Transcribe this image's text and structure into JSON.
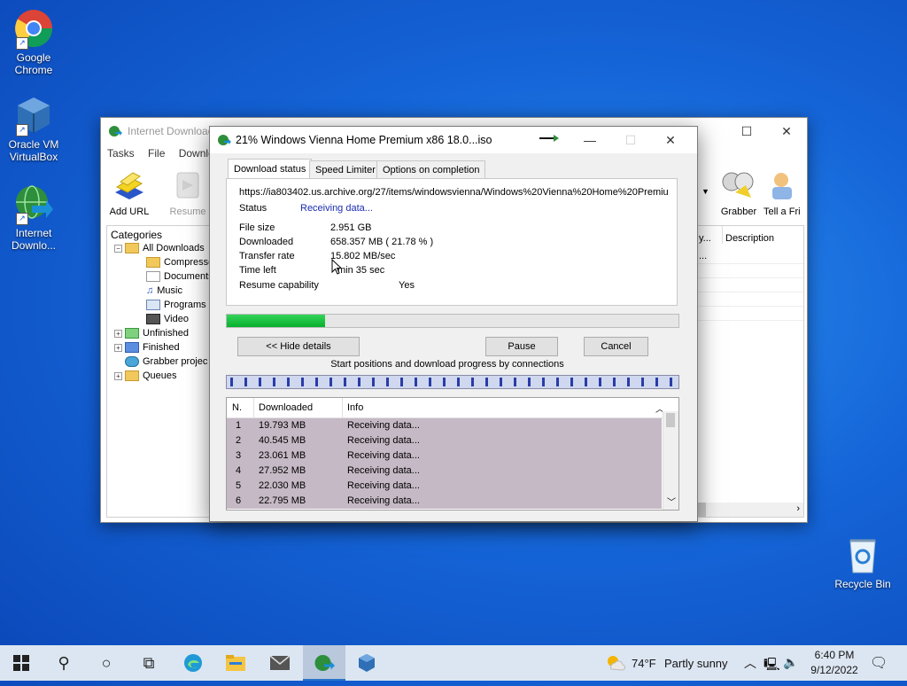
{
  "desktop": {
    "icons": [
      {
        "label": "Google Chrome"
      },
      {
        "label": "Oracle VM VirtualBox"
      },
      {
        "label": "Internet Downlo..."
      },
      {
        "label": "Recycle Bin"
      }
    ]
  },
  "idm": {
    "title": "Internet Download",
    "menu": [
      "Tasks",
      "File",
      "Downlo"
    ],
    "toolbar": {
      "add_url": "Add URL",
      "resume": "Resume",
      "grabber": "Grabber",
      "tell": "Tell a Fri"
    },
    "categories_header": "Categories",
    "tree": [
      "All Downloads",
      "Compresse",
      "Documents",
      "Music",
      "Programs",
      "Video",
      "Unfinished",
      "Finished",
      "Grabber projec",
      "Queues"
    ],
    "col_fragment": "y...",
    "col_fragment2": "...",
    "col_description": "Description"
  },
  "dialog": {
    "title": "21% Windows Vienna Home Premium x86 18.0...iso",
    "tabs": [
      "Download status",
      "Speed Limiter",
      "Options on completion"
    ],
    "url": "https://ia803402.us.archive.org/27/items/windowsvienna/Windows%20Vienna%20Home%20Premiu",
    "status_label": "Status",
    "status_value": "Receiving data...",
    "file_size_label": "File size",
    "file_size_value": "2.951  GB",
    "downloaded_label": "Downloaded",
    "downloaded_value": "658.357  MB  ( 21.78 % )",
    "transfer_label": "Transfer rate",
    "transfer_value": "15.802  MB/sec",
    "time_left_label": "Time left",
    "time_left_value": "min 35 sec",
    "resume_label": "Resume capability",
    "resume_value": "Yes",
    "progress": 0.2178,
    "hide_details": "<< Hide details",
    "pause": "Pause",
    "cancel": "Cancel",
    "connections_caption": "Start positions and download progress by connections",
    "list_headers": [
      "N.",
      "Downloaded",
      "Info"
    ],
    "connections": [
      {
        "n": "1",
        "downloaded": "19.793  MB",
        "info": "Receiving data..."
      },
      {
        "n": "2",
        "downloaded": "40.545  MB",
        "info": "Receiving data..."
      },
      {
        "n": "3",
        "downloaded": "23.061  MB",
        "info": "Receiving data..."
      },
      {
        "n": "4",
        "downloaded": "27.952  MB",
        "info": "Receiving data..."
      },
      {
        "n": "5",
        "downloaded": "22.030  MB",
        "info": "Receiving data..."
      },
      {
        "n": "6",
        "downloaded": "22.795  MB",
        "info": "Receiving data..."
      }
    ]
  },
  "taskbar": {
    "weather_temp": "74°F",
    "weather_text": "Partly sunny",
    "time": "6:40 PM",
    "date": "9/12/2022"
  }
}
